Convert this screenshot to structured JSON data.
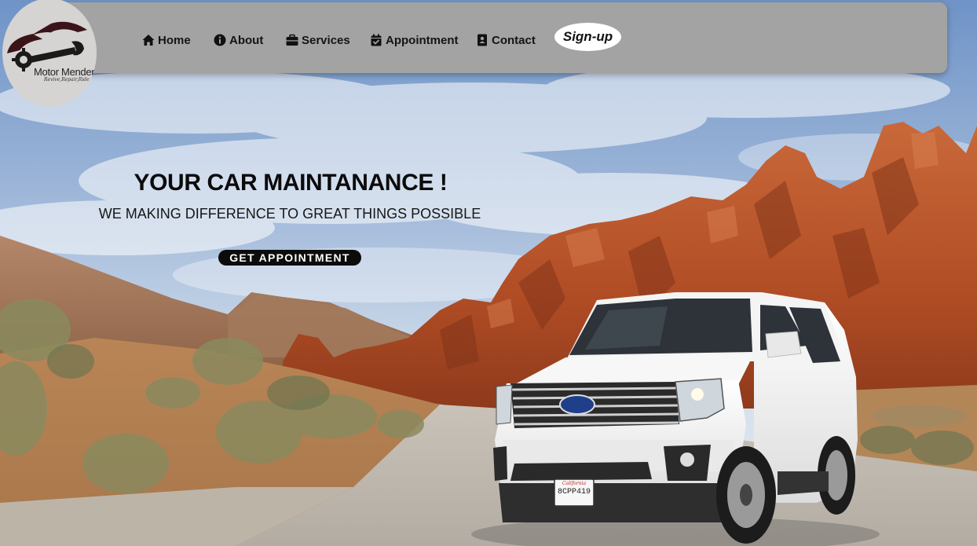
{
  "logo": {
    "name": "Motor Menders",
    "tagline": "Revive,Repair,Ride"
  },
  "nav": {
    "items": [
      {
        "label": "Home",
        "icon": "home-icon"
      },
      {
        "label": "About",
        "icon": "info-icon"
      },
      {
        "label": "Services",
        "icon": "briefcase-icon"
      },
      {
        "label": "Appointment",
        "icon": "calendar-check-icon"
      },
      {
        "label": "Contact",
        "icon": "address-card-icon"
      }
    ],
    "signup_label": "Sign-up"
  },
  "hero": {
    "title": "YOUR CAR MAINTANANCE !",
    "subtitle": "WE MAKING DIFFERENCE TO GREAT THINGS POSSIBLE",
    "cta_label": "GET APPOINTMENT"
  },
  "background": {
    "subject": "white Ford SUV on desert gravel road with red rock formations",
    "license_plate": "8CPP419",
    "plate_state": "California",
    "colors": {
      "sky_top": "#6f93c7",
      "sky_bottom": "#dfe8f2",
      "rock": "#c05a2e",
      "sand": "#b07a4a",
      "car": "#f1f1f1",
      "nav_bg": "#a3a3a3"
    }
  }
}
